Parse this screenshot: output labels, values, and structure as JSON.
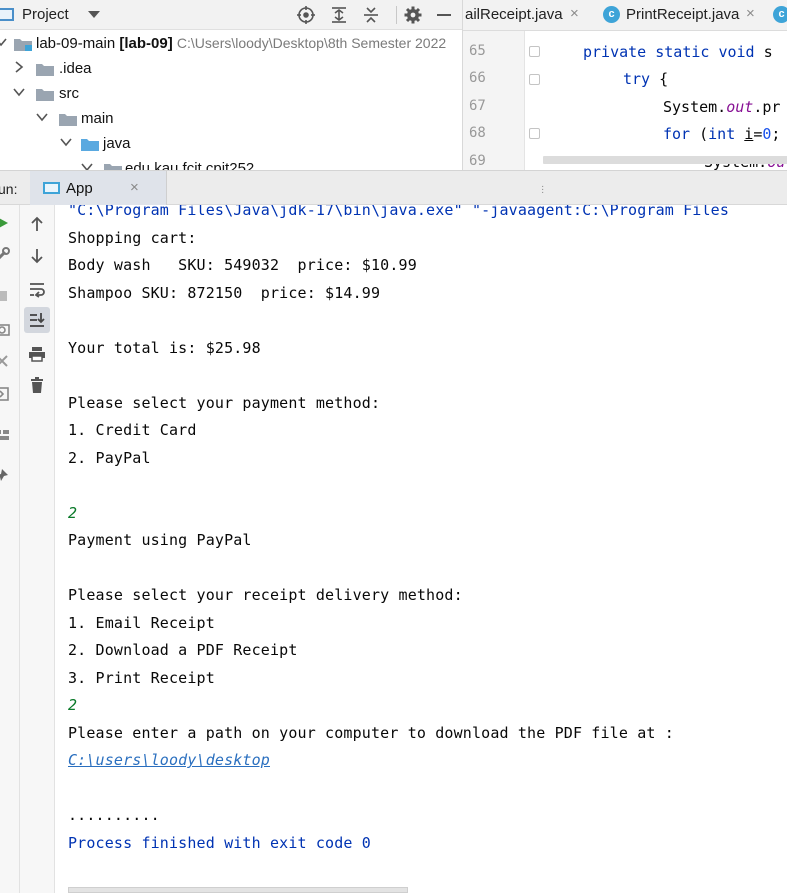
{
  "project": {
    "title": "Project",
    "tree": [
      {
        "label": "lab-09-main",
        "bold_suffix": "[lab-09]",
        "path": "C:\\Users\\loody\\Desktop\\8th Semester 2022"
      },
      {
        "label": ".idea"
      },
      {
        "label": "src"
      },
      {
        "label": "main"
      },
      {
        "label": "java"
      },
      {
        "label": "edu.kau.fcit.cpit252"
      }
    ]
  },
  "editor": {
    "tabs": [
      {
        "label": "ailReceipt.java",
        "close": "×"
      },
      {
        "label": "PrintReceipt.java",
        "close": "×",
        "badge": "c"
      },
      {
        "badge": "c"
      }
    ],
    "line_numbers": [
      "65",
      "66",
      "67",
      "68",
      "69"
    ]
  },
  "run": {
    "label": "un:",
    "tab_label": "App",
    "tab_close": "×"
  },
  "console": {
    "lines": [
      {
        "text": "\"C:\\Program Files\\Java\\jdk-17\\bin\\java.exe\" \"-javaagent:C:\\Program Files",
        "kind": "blue"
      },
      {
        "text": "Shopping cart:",
        "kind": "normal"
      },
      {
        "text": "Body wash   SKU: 549032  price: $10.99",
        "kind": "normal"
      },
      {
        "text": "Shampoo SKU: 872150  price: $14.99",
        "kind": "normal"
      },
      {
        "text": "",
        "kind": "normal"
      },
      {
        "text": "Your total is: $25.98",
        "kind": "normal"
      },
      {
        "text": "",
        "kind": "normal"
      },
      {
        "text": "Please select your payment method:",
        "kind": "normal"
      },
      {
        "text": "1. Credit Card",
        "kind": "normal"
      },
      {
        "text": "2. PayPal",
        "kind": "normal"
      },
      {
        "text": "",
        "kind": "normal"
      },
      {
        "text": "2",
        "kind": "input"
      },
      {
        "text": "Payment using PayPal",
        "kind": "normal"
      },
      {
        "text": "",
        "kind": "normal"
      },
      {
        "text": "Please select your receipt delivery method:",
        "kind": "normal"
      },
      {
        "text": "1. Email Receipt",
        "kind": "normal"
      },
      {
        "text": "2. Download a PDF Receipt",
        "kind": "normal"
      },
      {
        "text": "3. Print Receipt",
        "kind": "normal"
      },
      {
        "text": "2",
        "kind": "input"
      },
      {
        "text": "Please enter a path on your computer to download the PDF file at :",
        "kind": "normal"
      },
      {
        "text": "C:\\users\\loody\\desktop",
        "kind": "link"
      },
      {
        "text": "",
        "kind": "normal"
      },
      {
        "text": "..........",
        "kind": "normal"
      },
      {
        "text": "Process finished with exit code 0",
        "kind": "blue"
      }
    ]
  },
  "colors": {
    "keyword": "#0033b3",
    "static_field": "#871094",
    "number": "#1750eb",
    "user_input": "#0b7a2a",
    "link": "#2a6fbf",
    "class_badge": "#3ea4d8"
  }
}
